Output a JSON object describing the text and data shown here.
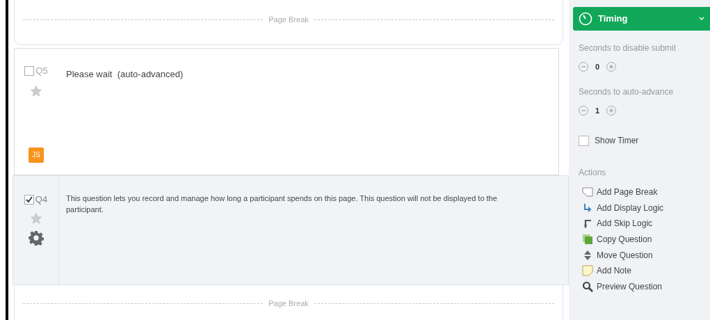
{
  "page_breaks": [
    {
      "label": "Page Break"
    },
    {
      "label": "Page Break"
    }
  ],
  "questions": [
    {
      "number": "Q5",
      "checked": false,
      "selected": false,
      "text": "Please wait  (auto-advanced)",
      "badge": "JS",
      "settings": false
    },
    {
      "number": "Q4",
      "checked": true,
      "selected": true,
      "text": "This question lets you record and manage how long a participant spends on this page. This question will not be displayed to the participant.",
      "settings": true
    }
  ],
  "panel": {
    "title": "Timing",
    "expanded": true,
    "steppers": [
      {
        "label": "Seconds to disable submit",
        "value": "0"
      },
      {
        "label": "Seconds to auto-advance",
        "value": "1"
      }
    ],
    "show_timer": {
      "label": "Show Timer",
      "checked": false
    },
    "actions_title": "Actions",
    "actions": [
      {
        "kind": "page-break",
        "label": "Add Page Break"
      },
      {
        "kind": "display-logic",
        "label": "Add Display Logic"
      },
      {
        "kind": "skip-logic",
        "label": "Add Skip Logic"
      },
      {
        "kind": "copy",
        "label": "Copy Question"
      },
      {
        "kind": "move",
        "label": "Move Question"
      },
      {
        "kind": "note",
        "label": "Add Note"
      },
      {
        "kind": "preview",
        "label": "Preview Question"
      }
    ]
  }
}
